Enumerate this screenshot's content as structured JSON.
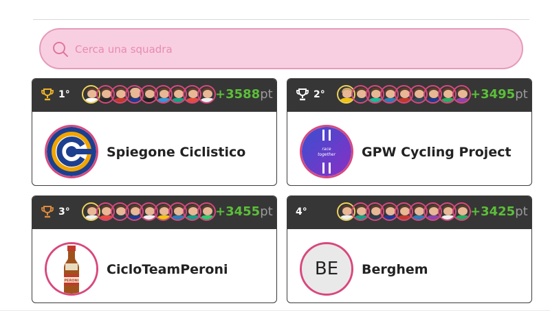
{
  "search": {
    "placeholder": "Cerca una squadra"
  },
  "teams": [
    {
      "rank": "1°",
      "trophy": true,
      "points": "+3588",
      "unit": "pt",
      "name": "Spiegone Ciclistico",
      "logo": "cycling-gear-logo"
    },
    {
      "rank": "2°",
      "trophy": true,
      "points": "+3495",
      "unit": "pt",
      "name": "GPW Cycling Project",
      "logo": "race-together-logo",
      "logo_text": [
        "race",
        "together"
      ]
    },
    {
      "rank": "3°",
      "trophy": true,
      "points": "+3455",
      "unit": "pt",
      "name": "CicloTeamPeroni",
      "logo": "peroni-bottle-logo",
      "logo_text": [
        "PERONI"
      ]
    },
    {
      "rank": "4°",
      "trophy": false,
      "points": "+3425",
      "unit": "pt",
      "name": "Berghem",
      "logo": "initials-logo",
      "initials": "BE"
    }
  ],
  "colors": {
    "accent_pink": "#d9487c",
    "search_bg": "#f8cfe0",
    "header_bg": "#363636",
    "points_green": "#5cbf3a",
    "trophy_gold": "#f0b429"
  }
}
